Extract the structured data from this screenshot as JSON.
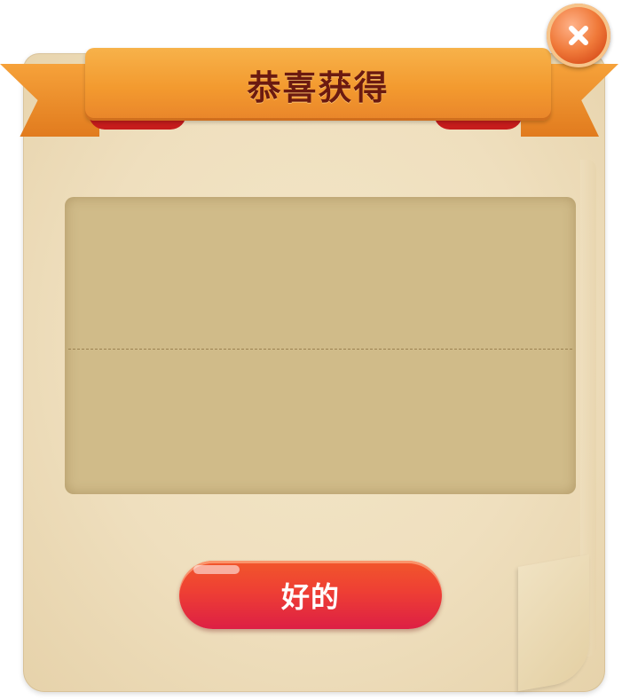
{
  "dialog": {
    "title": "恭喜获得",
    "confirm_label": "好的",
    "close_icon": "close-icon",
    "colors": {
      "ribbon": "#f39a2f",
      "title_text": "#6b1a10",
      "parchment": "#efdfbe",
      "reward_area": "#d0bb89",
      "button": "#ee3f34",
      "close_button": "#f07a3a"
    }
  }
}
